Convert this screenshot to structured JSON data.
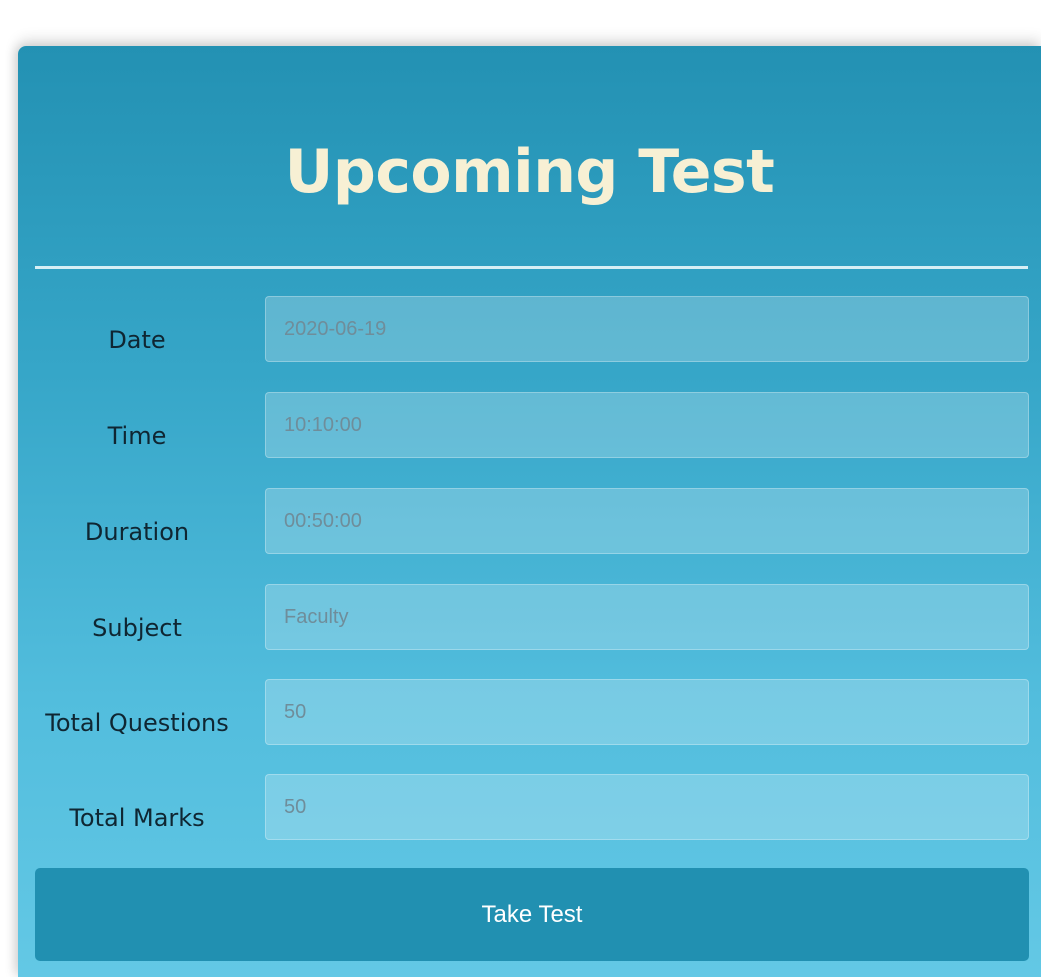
{
  "card": {
    "title": "Upcoming Test"
  },
  "fields": [
    {
      "label": "Date",
      "value": "2020-06-19"
    },
    {
      "label": "Time",
      "value": "10:10:00"
    },
    {
      "label": "Duration",
      "value": "00:50:00"
    },
    {
      "label": "Subject",
      "value": "Faculty"
    },
    {
      "label": "Total Questions",
      "value": "50"
    },
    {
      "label": "Total Marks",
      "value": "50"
    }
  ],
  "actions": {
    "take_test_label": "Take Test"
  },
  "colors": {
    "card_top": "#2391b3",
    "card_bottom": "#63c8e5",
    "title_text": "#f7f0d4",
    "button_bg": "#2190b1"
  }
}
